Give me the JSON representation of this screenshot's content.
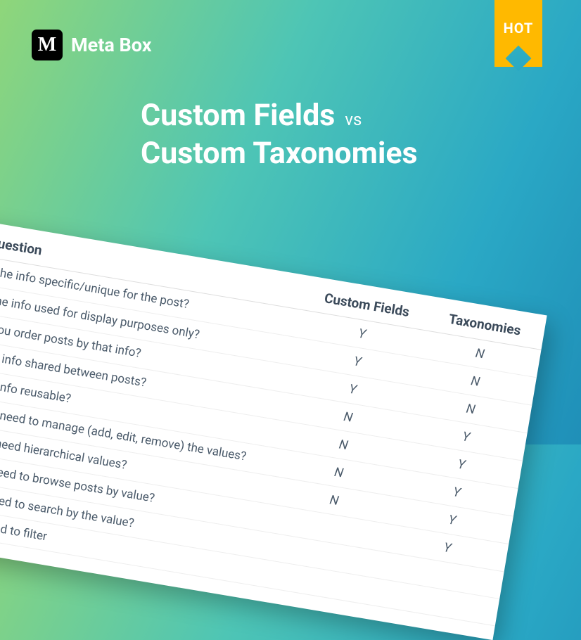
{
  "logo": {
    "mark": "M",
    "text": "Meta Box"
  },
  "badge": {
    "label": "HOT"
  },
  "title": {
    "line1": "Custom Fields",
    "vs": "vs",
    "line2": "Custom Taxonomies"
  },
  "table": {
    "headers": {
      "question": "Question",
      "custom_fields": "Custom Fields",
      "taxonomies": "Taxonomies"
    },
    "rows": [
      {
        "q": "Is the info specific/unique for the post?",
        "cf": "Y",
        "tx": "N"
      },
      {
        "q": "Is the info used for display purposes only?",
        "cf": "Y",
        "tx": "N"
      },
      {
        "q": "Do you order posts by that info?",
        "cf": "Y",
        "tx": "N"
      },
      {
        "q": "Is the info shared between posts?",
        "cf": "N",
        "tx": "Y"
      },
      {
        "q": "Is the info reusable?",
        "cf": "N",
        "tx": "Y"
      },
      {
        "q": "Do you need to manage (add, edit, remove) the values?",
        "cf": "N",
        "tx": "Y"
      },
      {
        "q": "Do you need hierarchical values?",
        "cf": "N",
        "tx": "Y"
      },
      {
        "q": "Do you need to browse posts by value?",
        "cf": "",
        "tx": "Y"
      },
      {
        "q": "Do you need to search by the value?",
        "cf": "",
        "tx": ""
      },
      {
        "q": "Do you need to filter",
        "cf": "",
        "tx": ""
      }
    ]
  }
}
